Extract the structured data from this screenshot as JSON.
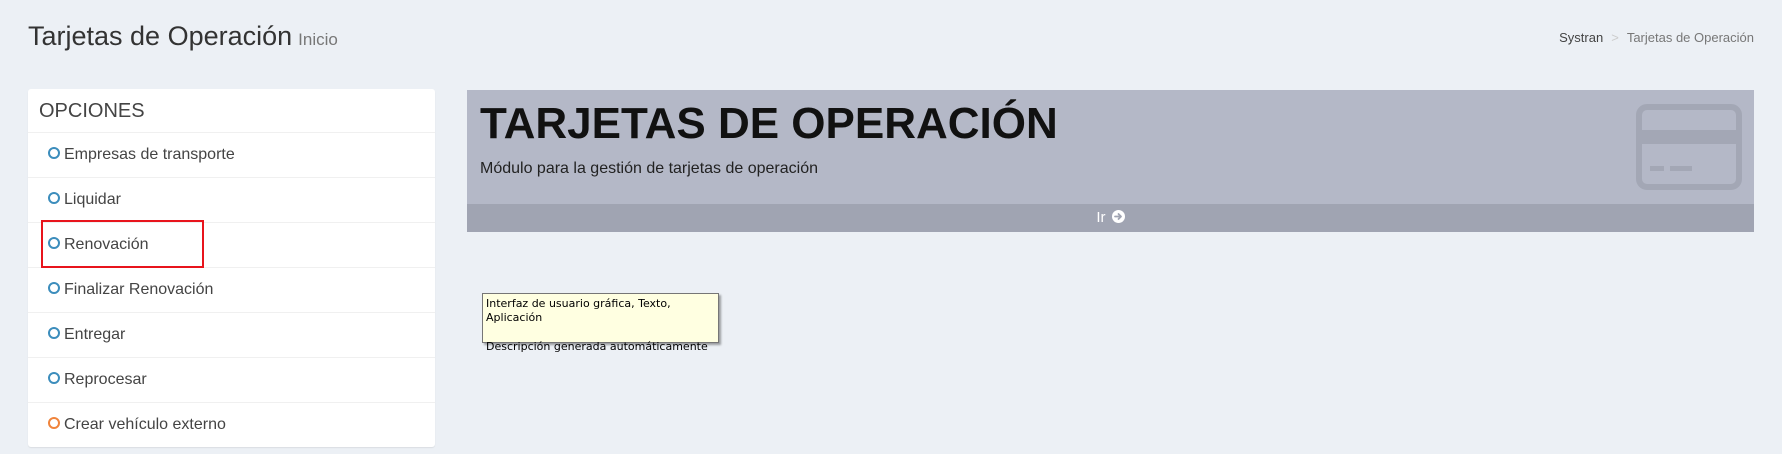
{
  "header": {
    "title": "Tarjetas de Operación",
    "subtitle": "Inicio",
    "breadcrumb": {
      "root": "Systran",
      "separator": ">",
      "current": "Tarjetas de Operación"
    }
  },
  "sidebar": {
    "title": "OPCIONES",
    "items": [
      {
        "label": "Empresas de transporte",
        "icon": "circle-o-icon",
        "color": "#3c8dbc"
      },
      {
        "label": "Liquidar",
        "icon": "circle-o-icon",
        "color": "#3c8dbc"
      },
      {
        "label": "Renovación",
        "icon": "circle-o-icon",
        "color": "#3c8dbc",
        "highlighted": true
      },
      {
        "label": "Finalizar Renovación",
        "icon": "circle-o-icon",
        "color": "#3c8dbc"
      },
      {
        "label": "Entregar",
        "icon": "circle-o-icon",
        "color": "#3c8dbc"
      },
      {
        "label": "Reprocesar",
        "icon": "circle-o-icon",
        "color": "#3c8dbc"
      },
      {
        "label": "Crear vehículo externo",
        "icon": "circle-o-icon",
        "color": "#f0843c"
      }
    ]
  },
  "module_box": {
    "title": "TARJETAS DE OPERACIÓN",
    "description": "Módulo para la gestión de tarjetas de operación",
    "footer_link": "Ir",
    "icon": "credit-card-icon",
    "background": "#b4b8c7"
  },
  "tooltip": {
    "line1": "Interfaz de usuario gráfica, Texto, Aplicación",
    "line2": "Descripción generada automáticamente"
  },
  "colors": {
    "accent": "#3c8dbc",
    "highlight": "#e8141c",
    "page_bg": "#ecf0f5"
  }
}
